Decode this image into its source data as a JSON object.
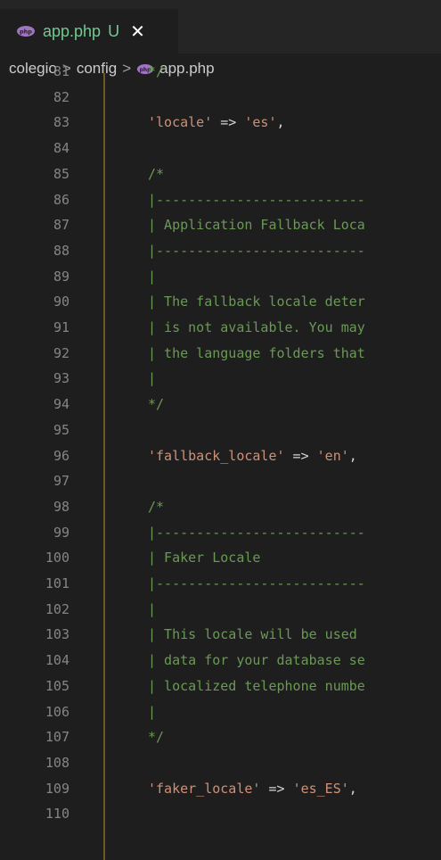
{
  "tab": {
    "filename": "app.php",
    "status": "U",
    "close_glyph": "✕",
    "icon": "php-icon"
  },
  "breadcrumb": {
    "items": [
      "colegio",
      "config",
      "app.php"
    ],
    "separator": ">"
  },
  "colors": {
    "comment": "#6a9955",
    "string": "#ce9178",
    "line_number": "#858585",
    "modified_file": "#73c991"
  },
  "editor": {
    "lines": [
      {
        "n": "81",
        "code": "*/",
        "kind": "comment"
      },
      {
        "n": "82",
        "code": "",
        "kind": "blank"
      },
      {
        "n": "83",
        "key": "'locale'",
        "op": " => ",
        "val": "'es'",
        "end": ",",
        "kind": "assign"
      },
      {
        "n": "84",
        "code": "",
        "kind": "blank"
      },
      {
        "n": "85",
        "code": "/*",
        "kind": "comment"
      },
      {
        "n": "86",
        "code": "|--------------------------",
        "kind": "comment"
      },
      {
        "n": "87",
        "code": "| Application Fallback Loca",
        "kind": "comment"
      },
      {
        "n": "88",
        "code": "|--------------------------",
        "kind": "comment"
      },
      {
        "n": "89",
        "code": "|",
        "kind": "comment"
      },
      {
        "n": "90",
        "code": "| The fallback locale deter",
        "kind": "comment"
      },
      {
        "n": "91",
        "code": "| is not available. You may",
        "kind": "comment"
      },
      {
        "n": "92",
        "code": "| the language folders that",
        "kind": "comment"
      },
      {
        "n": "93",
        "code": "|",
        "kind": "comment"
      },
      {
        "n": "94",
        "code": "*/",
        "kind": "comment"
      },
      {
        "n": "95",
        "code": "",
        "kind": "blank"
      },
      {
        "n": "96",
        "key": "'fallback_locale'",
        "op": " => ",
        "val": "'en'",
        "end": ",",
        "kind": "assign"
      },
      {
        "n": "97",
        "code": "",
        "kind": "blank"
      },
      {
        "n": "98",
        "code": "/*",
        "kind": "comment"
      },
      {
        "n": "99",
        "code": "|--------------------------",
        "kind": "comment"
      },
      {
        "n": "100",
        "code": "| Faker Locale",
        "kind": "comment"
      },
      {
        "n": "101",
        "code": "|--------------------------",
        "kind": "comment"
      },
      {
        "n": "102",
        "code": "|",
        "kind": "comment"
      },
      {
        "n": "103",
        "code": "| This locale will be used",
        "kind": "comment"
      },
      {
        "n": "104",
        "code": "| data for your database se",
        "kind": "comment"
      },
      {
        "n": "105",
        "code": "| localized telephone numbe",
        "kind": "comment"
      },
      {
        "n": "106",
        "code": "|",
        "kind": "comment"
      },
      {
        "n": "107",
        "code": "*/",
        "kind": "comment"
      },
      {
        "n": "108",
        "code": "",
        "kind": "blank"
      },
      {
        "n": "109",
        "key": "'faker_locale'",
        "op": " => ",
        "val": "'es_ES'",
        "end": ",",
        "kind": "assign"
      },
      {
        "n": "110",
        "code": "",
        "kind": "blank"
      }
    ]
  }
}
